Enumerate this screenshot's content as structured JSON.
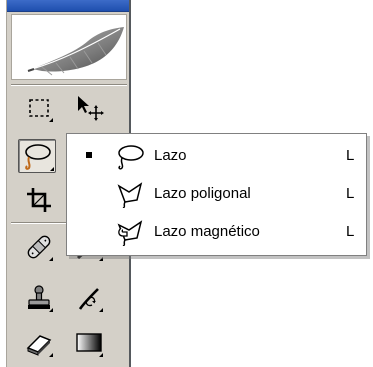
{
  "toolbox": {
    "tools": [
      {
        "id": "marquee",
        "icon": "rect-marquee-icon"
      },
      {
        "id": "move",
        "icon": "move-icon"
      },
      {
        "id": "lasso",
        "icon": "lasso-icon",
        "active": true
      },
      {
        "id": "crop",
        "icon": "crop-icon"
      },
      {
        "id": "healing",
        "icon": "healing-brush-icon"
      },
      {
        "id": "brush",
        "icon": "brush-icon"
      },
      {
        "id": "stamp",
        "icon": "clone-stamp-icon"
      },
      {
        "id": "history-brush",
        "icon": "history-brush-icon"
      },
      {
        "id": "eraser",
        "icon": "eraser-icon"
      },
      {
        "id": "gradient",
        "icon": "gradient-icon"
      }
    ]
  },
  "flyout": {
    "items": [
      {
        "label": "Lazo",
        "shortcut": "L",
        "selected": true,
        "icon": "lasso-icon"
      },
      {
        "label": "Lazo poligonal",
        "shortcut": "L",
        "selected": false,
        "icon": "polygonal-lasso-icon"
      },
      {
        "label": "Lazo magnético",
        "shortcut": "L",
        "selected": false,
        "icon": "magnetic-lasso-icon"
      }
    ]
  }
}
